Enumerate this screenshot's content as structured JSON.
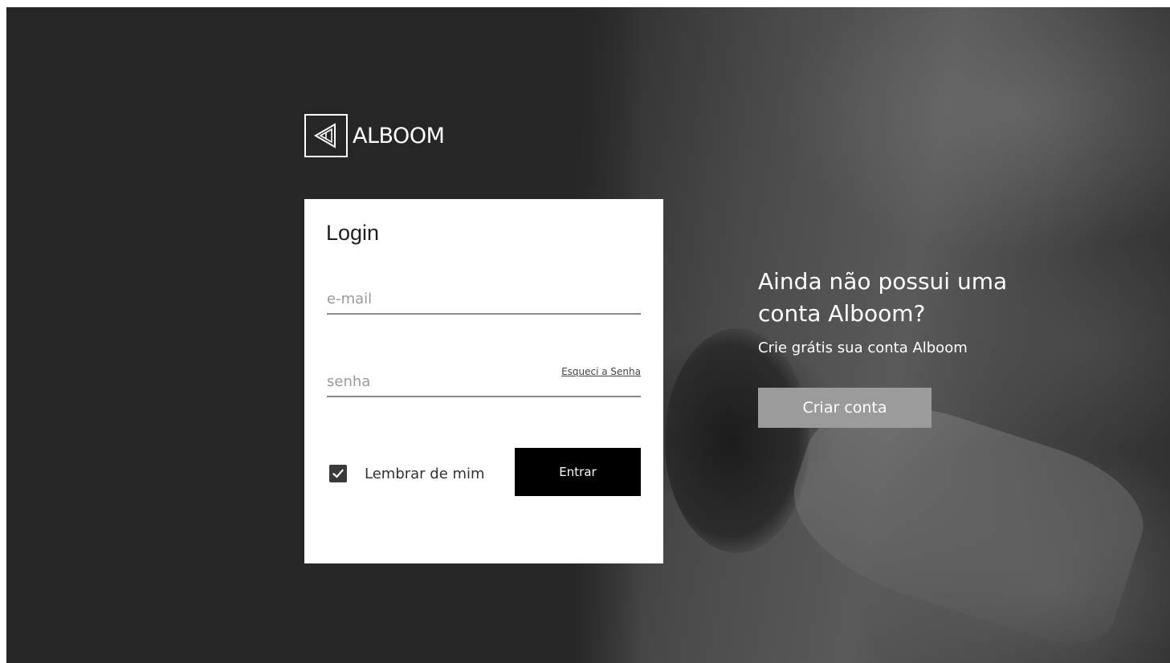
{
  "brand": {
    "name": "ALBOOM",
    "logo_icon": "alboom-triangle-logo-icon"
  },
  "login": {
    "title": "Login",
    "email_placeholder": "e-mail",
    "email_value": "",
    "password_placeholder": "senha",
    "password_value": "",
    "forgot_label": "Esqueci a Senha",
    "remember_label": "Lembrar de mim",
    "remember_checked": true,
    "submit_label": "Entrar"
  },
  "signup": {
    "heading": "Ainda não possui uma conta Alboom?",
    "subheading": "Crie grátis sua conta Alboom",
    "button_label": "Criar conta"
  },
  "colors": {
    "submit_bg": "#000000",
    "signup_button_bg": "#9b9b9b",
    "checkbox_bg": "#3a3a3a"
  }
}
